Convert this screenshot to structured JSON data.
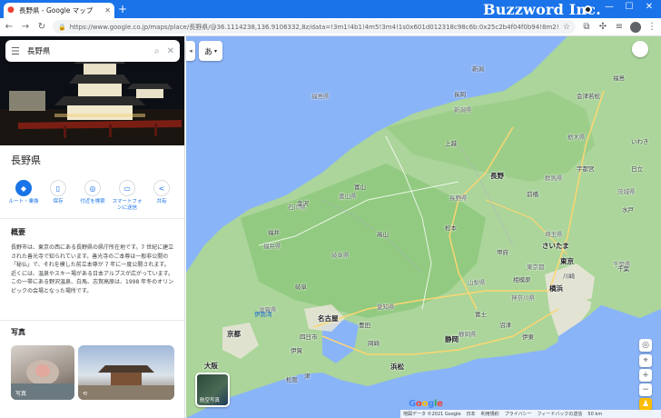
{
  "browser": {
    "tab_title": "長野県 - Google マップ",
    "tab_close": "✕",
    "new_tab": "+",
    "brand_overlay": "Buzzword Inc.",
    "url": "https://www.google.co.jp/maps/place/長野県/@36.1114238,136.9106332,8z/data=!3m1!4b1!4m5!3m4!1s0x601d012318c98c6b:0x25c2b4f04f0b94!8m2!3d36.1543941!4d137.92...",
    "window_minimize": "—",
    "window_maximize": "☐",
    "window_close": "✕"
  },
  "sidebar": {
    "search_value": "長野県",
    "place_title": "長野県",
    "actions": [
      {
        "label": "ルート・乗換",
        "icon": "directions-icon"
      },
      {
        "label": "保存",
        "icon": "bookmark-icon"
      },
      {
        "label": "付近を検索",
        "icon": "nearby-icon"
      },
      {
        "label": "スマートフォンに送信",
        "icon": "phone-icon"
      },
      {
        "label": "共有",
        "icon": "share-icon"
      }
    ],
    "overview_heading": "概要",
    "overview_text": "長野市は、東京の西にある長野県の県庁所在地です。7 世紀に建立された善光寺で知られています。善光寺のご本尊は一般非公開の「秘仏」で、それを模した前立本尊が 7 年に一度公開されます。近くには、温泉やスキー場がある日本アルプスが広がっています。この一帯にある野沢温泉、白馬、志賀高原は、1998 年冬のオリンピックの会場となった場所です。",
    "photos_heading": "写真",
    "photos": [
      {
        "label": "写真"
      },
      {
        "label": "⟲"
      }
    ]
  },
  "map": {
    "lang_button": "あ",
    "collapse_arrow": "◂",
    "labels": {
      "prefectures": [
        "新潟県",
        "長野県",
        "富山県",
        "石川県",
        "福井県",
        "岐阜県",
        "群馬県",
        "栃木県",
        "茨城県",
        "埼玉県",
        "山梨県",
        "静岡県",
        "愛知県",
        "滋賀県",
        "東京都",
        "神奈川県",
        "千葉県",
        "福島県"
      ],
      "cities": [
        "長野",
        "さいたま",
        "東京",
        "横浜",
        "名古屋",
        "京都",
        "大阪",
        "静岡",
        "浜松",
        "上越",
        "富山",
        "金沢",
        "福井",
        "前橋",
        "宇都宮",
        "甲府",
        "伊賀",
        "津",
        "岐阜",
        "高山",
        "松本",
        "千葉",
        "水戸",
        "会津若松",
        "福島",
        "いわき",
        "日立",
        "沼津",
        "川崎",
        "伊東",
        "相模原",
        "富士",
        "長岡",
        "新潟",
        "四日市",
        "松阪",
        "豊田",
        "岡崎"
      ],
      "sea": "伊勢湾"
    },
    "scale": "50 km",
    "layer_label": "航空写真",
    "google_logo": "Google",
    "footer_items": [
      "地図データ ©2021 Google",
      "日本",
      "利用規約",
      "プライバシー",
      "フィードバックの送信",
      "50 km"
    ],
    "zoom_in": "+",
    "zoom_out": "−"
  },
  "colors": {
    "accent": "#1a73e8",
    "land": "#abd59a",
    "land_dark": "#8cc77a",
    "water": "#8ab4f8",
    "urban": "#e8e4d8",
    "road": "#fcd672"
  }
}
